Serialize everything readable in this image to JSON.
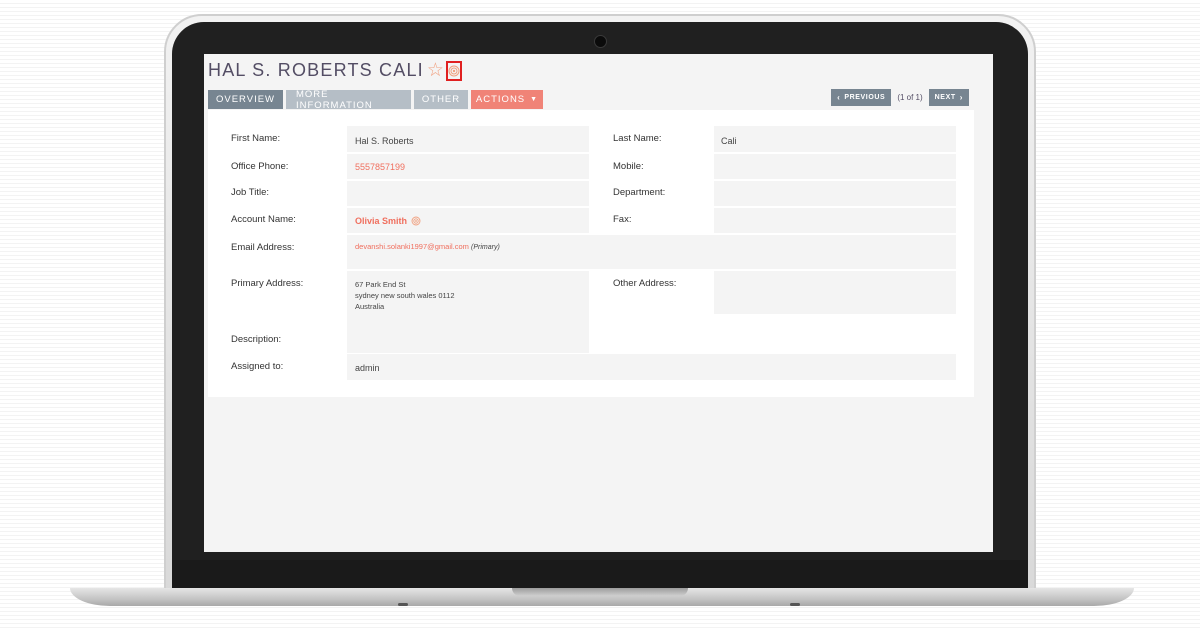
{
  "record": {
    "title": "HAL S. ROBERTS CALI"
  },
  "icons": {
    "favorite": "star-outline-icon",
    "view": "eye-icon",
    "account": "eye-icon"
  },
  "tabs": [
    {
      "label": "OVERVIEW",
      "active": true
    },
    {
      "label": "MORE INFORMATION",
      "active": false
    },
    {
      "label": "OTHER",
      "active": false
    },
    {
      "label": "ACTIONS",
      "active": false
    }
  ],
  "pager": {
    "previous": "PREVIOUS",
    "count": "(1 of 1)",
    "next": "NEXT"
  },
  "fields": {
    "first_name": {
      "label": "First Name:",
      "value": "Hal S. Roberts"
    },
    "last_name": {
      "label": "Last Name:",
      "value": "Cali"
    },
    "office_phone": {
      "label": "Office Phone:",
      "value": "5557857199"
    },
    "mobile": {
      "label": "Mobile:",
      "value": ""
    },
    "job_title": {
      "label": "Job Title:",
      "value": ""
    },
    "department": {
      "label": "Department:",
      "value": ""
    },
    "account_name": {
      "label": "Account Name:",
      "value": "Olivia Smith"
    },
    "fax": {
      "label": "Fax:",
      "value": ""
    },
    "email": {
      "label": "Email Address:",
      "value": "devanshi.solanki1997@gmail.com",
      "tag": "(Primary)"
    },
    "primary_address": {
      "label": "Primary Address:",
      "line1": "67 Park End St",
      "line2": "sydney new south wales  0112",
      "line3": "Australia"
    },
    "other_address": {
      "label": "Other Address:",
      "value": ""
    },
    "description": {
      "label": "Description:",
      "value": ""
    },
    "assigned_to": {
      "label": "Assigned to:",
      "value": "admin"
    }
  },
  "colors": {
    "accent": "#f08377",
    "link": "#f06f5e",
    "tab_active": "#778591",
    "tab_inactive": "#b5bec6",
    "title": "#534d64",
    "highlight_box": "#e02020"
  }
}
